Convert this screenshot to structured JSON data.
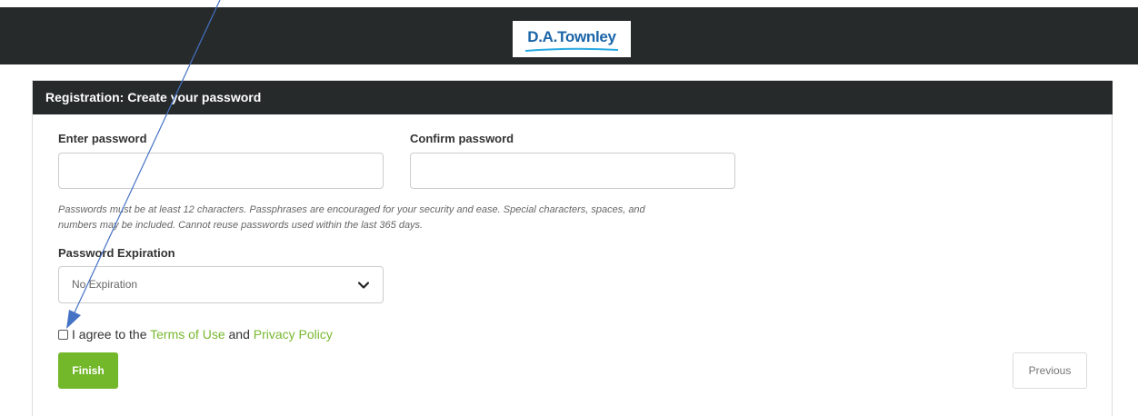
{
  "header": {
    "logo_text": "D.A.Townley",
    "brand_color": "#1a64a8"
  },
  "panel": {
    "title": "Registration: Create your password"
  },
  "form": {
    "password_label": "Enter password",
    "password_value": "",
    "confirm_label": "Confirm password",
    "confirm_value": "",
    "hint_line1": "Passwords must be at least 12 characters. Passphrases are encouraged for your security and ease. Special characters, spaces, and",
    "hint_line2": "numbers may be included. Cannot reuse passwords used within the last 365 days.",
    "expiration_label": "Password Expiration",
    "expiration_selected": "No Expiration",
    "agree_prefix": "I agree to the ",
    "terms_link": "Terms of Use",
    "agree_and": " and ",
    "privacy_link": "Privacy Policy",
    "agree_checked": false
  },
  "buttons": {
    "finish_label": "Finish",
    "previous_label": "Previous"
  },
  "colors": {
    "topbar": "#272a2b",
    "accent_green": "#73b72b",
    "link_green": "#78b831",
    "annotation_arrow": "#4472c4"
  },
  "icons": {
    "dropdown": "chevron-down-icon",
    "annotation": "arrow-annotation"
  }
}
